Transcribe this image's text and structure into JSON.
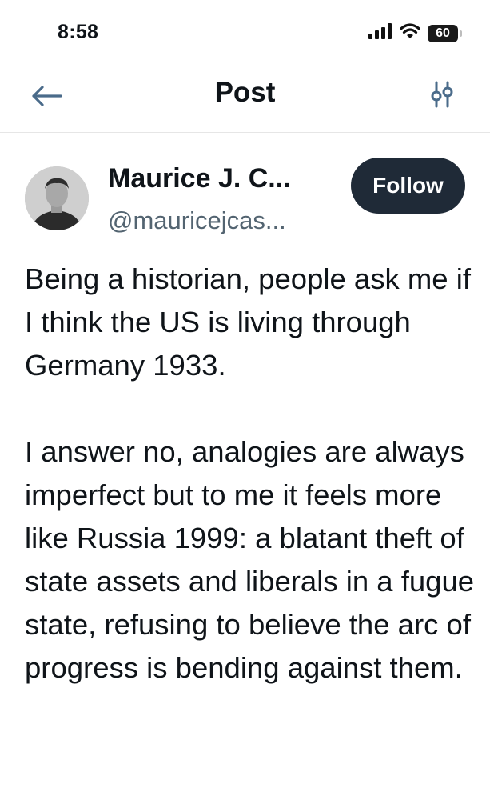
{
  "status_bar": {
    "time": "8:58",
    "battery_level": "60",
    "icons": [
      "signal-icon",
      "wifi-icon",
      "battery-icon"
    ]
  },
  "header": {
    "title": "Post",
    "back_icon": "back-arrow-icon",
    "filter_icon": "filter-settings-icon",
    "accent_color": "#4a6b8a"
  },
  "post": {
    "author": {
      "name": "Maurice J. C...",
      "handle": "@mauricejcas..."
    },
    "follow_label": "Follow",
    "paragraphs": [
      "Being a historian, people ask me if I think the US is living through Germany 1933.",
      "I answer no, analogies are always imperfect but to me it feels more like Russia 1999: a blatant theft of state assets and liberals in a fugue state, refusing to believe the arc of progress is bending against them."
    ]
  }
}
